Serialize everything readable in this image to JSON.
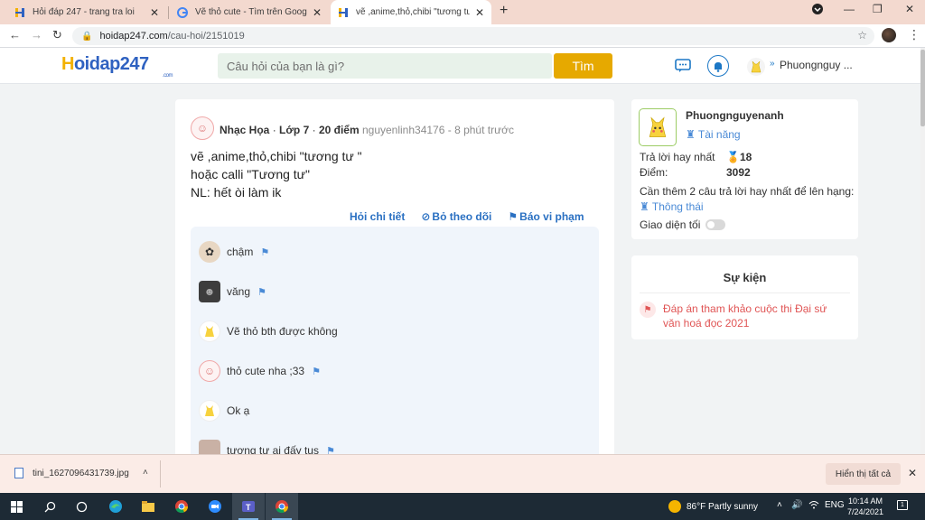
{
  "browser": {
    "tabs": [
      {
        "title": "Hỏi đáp 247 - trang tra loi",
        "active": false
      },
      {
        "title": "Vẽ thỏ cute - Tìm trên Google",
        "active": false
      },
      {
        "title": "vẽ ,anime,thỏ,chibi \"tương tư \" h",
        "active": true
      }
    ],
    "url_host": "hoidap247.com",
    "url_path": "/cau-hoi/2151019"
  },
  "site": {
    "logo": "oidap247",
    "logo_h": "H",
    "logo_com": ".com",
    "search_placeholder": "Câu hỏi của bạn là gì?",
    "search_button": "Tìm",
    "user_name": "Phuongnguy ..."
  },
  "question": {
    "asker": "Nhạc Họa",
    "grade": "Lớp 7",
    "points": "20 điểm",
    "sep": "·",
    "ref": "nguyenlinh34176 - 8 phút trước",
    "lines": [
      "vẽ ,anime,thỏ,chibi \"tương tư \"",
      "hoặc calli \"Tương tư\"",
      "NL: hết òi làm ik"
    ],
    "actions": {
      "detail": "Hỏi chi tiết",
      "unfollow": "Bỏ theo dõi",
      "report": "Báo vi phạm"
    }
  },
  "comments": [
    {
      "text": "chậm",
      "flag": true
    },
    {
      "text": "văng",
      "flag": true
    },
    {
      "text": "Vẽ thỏ bth được không",
      "flag": false
    },
    {
      "text": "thỏ cute nha ;33",
      "flag": true
    },
    {
      "text": "Ok ạ",
      "flag": false
    },
    {
      "text": "tương tư ai đấy tus",
      "flag": true
    }
  ],
  "profile_card": {
    "name": "Phuongnguyenanh",
    "rank": "Tài năng",
    "best_label": "Trả lời hay nhất",
    "best_value": "18",
    "points_label": "Điểm:",
    "points_value": "3092",
    "next": "Cần thêm 2 câu trả lời hay nhất để lên hạng:",
    "next_rank": "Thông thái",
    "dark_mode": "Giao diện tối",
    "dark_mode_on": false
  },
  "event_card": {
    "title": "Sự kiện",
    "text": "Đáp án tham khảo cuộc thi Đại sứ văn hoá đọc 2021"
  },
  "download_bar": {
    "file": "tini_1627096431739.jpg",
    "show_all": "Hiển thị tất cả"
  },
  "taskbar": {
    "weather": "86°F  Partly sunny",
    "lang": "ENG",
    "time": "10:14 AM",
    "date": "7/24/2021",
    "notifications": "1"
  },
  "colors": {
    "accent": "#2a70c2",
    "search_button": "#e6a900",
    "event": "#e05555"
  }
}
